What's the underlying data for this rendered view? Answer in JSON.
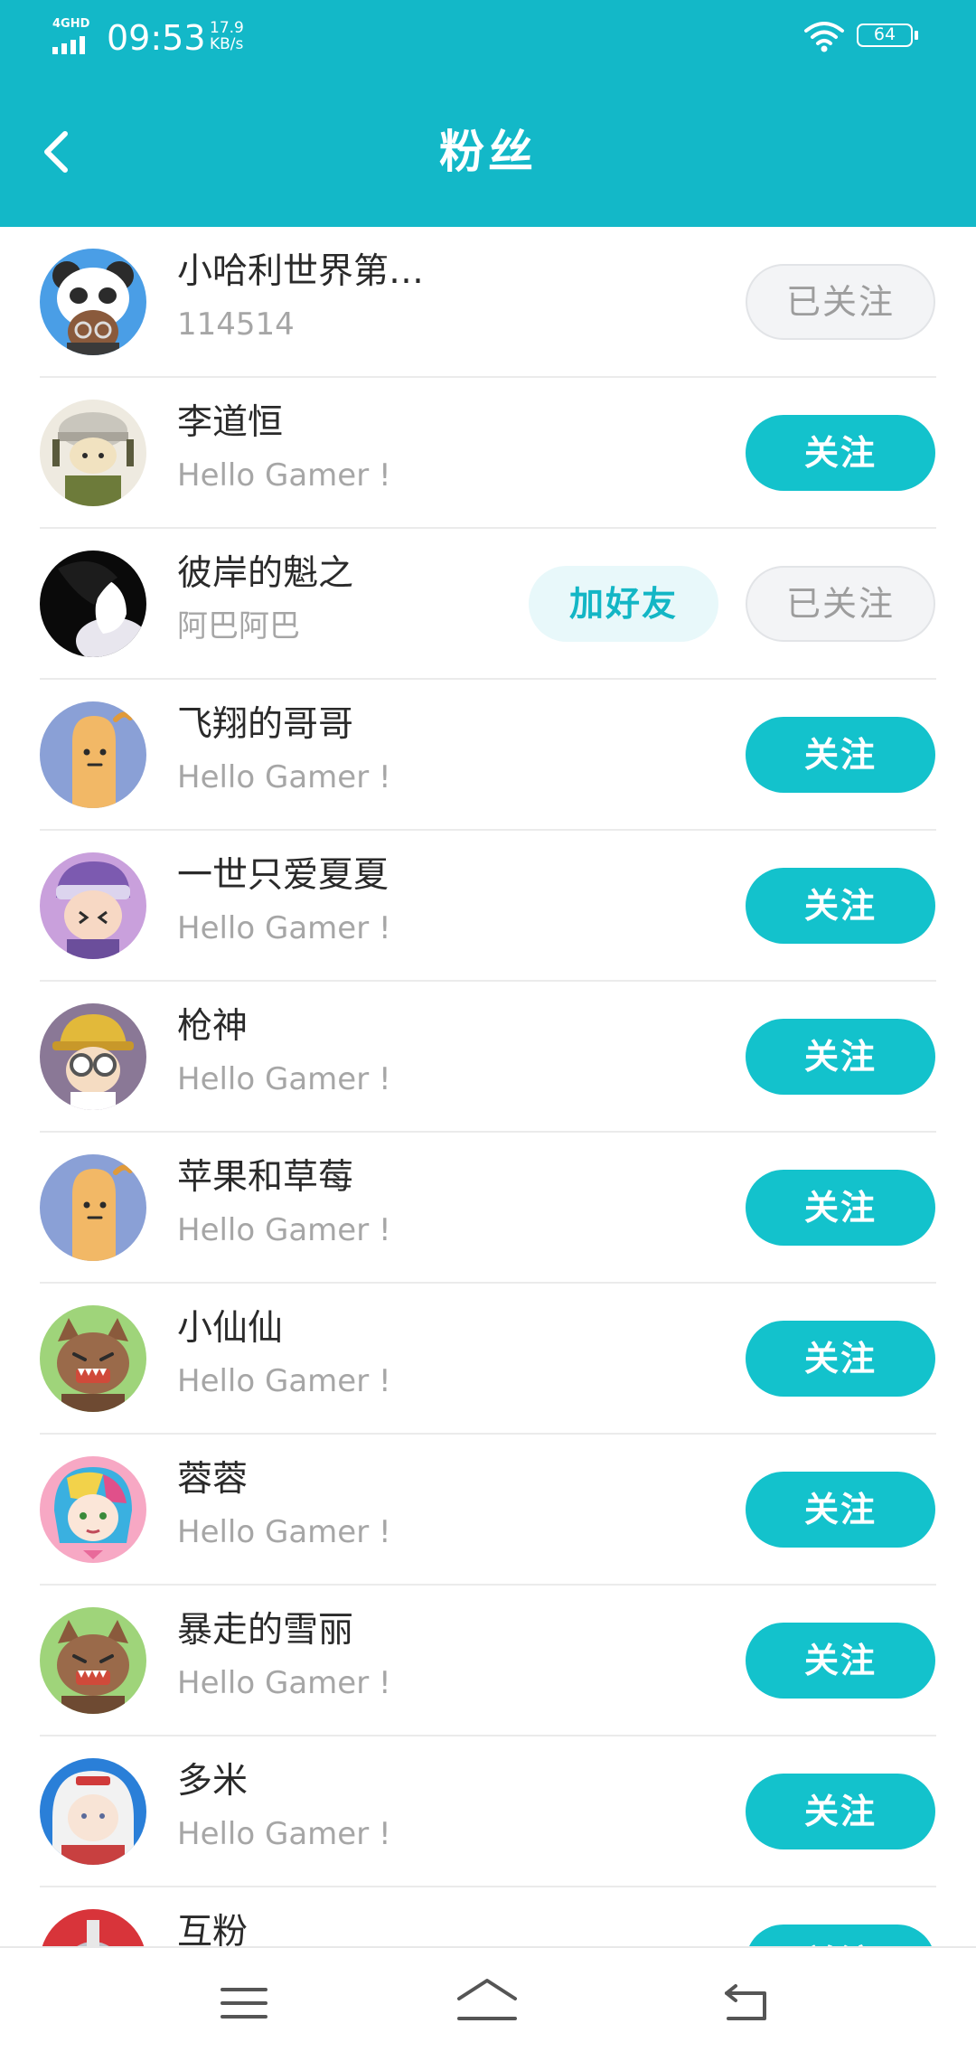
{
  "status_bar": {
    "network_type": "4GHD",
    "time": "09:53",
    "net_speed_value": "17.9",
    "net_speed_unit": "KB/s",
    "battery": "64"
  },
  "header": {
    "title": "粉丝",
    "back_icon": "chevron-left-icon"
  },
  "buttons": {
    "follow": "关注",
    "followed": "已关注",
    "add_friend": "加好友"
  },
  "fans": [
    {
      "name": "小哈利世界第…",
      "subtitle": "114514",
      "status": "followed",
      "add_friend": false,
      "avatar": "panda"
    },
    {
      "name": "李道恒",
      "subtitle": "Hello Gamer !",
      "status": "follow",
      "add_friend": false,
      "avatar": "helmet-soldier"
    },
    {
      "name": "彼岸的魁之",
      "subtitle": "阿巴阿巴",
      "status": "followed",
      "add_friend": true,
      "avatar": "dark-silhouette"
    },
    {
      "name": "飞翔的哥哥",
      "subtitle": "Hello Gamer !",
      "status": "follow",
      "add_friend": false,
      "avatar": "sausage"
    },
    {
      "name": "一世只爱夏夏",
      "subtitle": "Hello Gamer !",
      "status": "follow",
      "add_friend": false,
      "avatar": "athena"
    },
    {
      "name": "枪神",
      "subtitle": "Hello Gamer !",
      "status": "follow",
      "add_friend": false,
      "avatar": "goggles-hat"
    },
    {
      "name": "苹果和草莓",
      "subtitle": "Hello Gamer !",
      "status": "follow",
      "add_friend": false,
      "avatar": "sausage"
    },
    {
      "name": "小仙仙",
      "subtitle": "Hello Gamer !",
      "status": "follow",
      "add_friend": false,
      "avatar": "monster"
    },
    {
      "name": "蓉蓉",
      "subtitle": "Hello Gamer !",
      "status": "follow",
      "add_friend": false,
      "avatar": "rainbow-girl"
    },
    {
      "name": "暴走的雪丽",
      "subtitle": "Hello Gamer !",
      "status": "follow",
      "add_friend": false,
      "avatar": "monster"
    },
    {
      "name": "多米",
      "subtitle": "Hello Gamer !",
      "status": "follow",
      "add_friend": false,
      "avatar": "astronaut"
    },
    {
      "name": "互粉",
      "subtitle": "",
      "status": "follow",
      "add_friend": false,
      "avatar": "red-hero"
    }
  ],
  "colors": {
    "header_bg": "#13b8c8",
    "follow_bg": "#13c2cc",
    "followed_bg": "#f3f4f6",
    "add_friend_bg": "#e8f8fa",
    "add_friend_text": "#13b6c5"
  },
  "nav": {
    "menu_icon": "menu-icon",
    "home_icon": "home-icon",
    "back_icon": "back-icon"
  }
}
